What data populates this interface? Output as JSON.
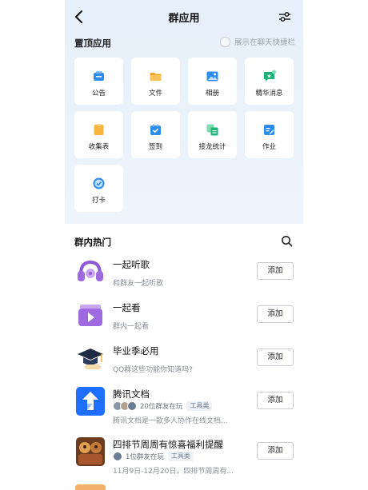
{
  "nav": {
    "title": "群应用"
  },
  "pinned": {
    "label": "置顶应用",
    "shortcut_text": "展示在聊天快捷栏",
    "apps": [
      {
        "label": "公告",
        "icon": "announcement-icon",
        "color": "#2d8cf0"
      },
      {
        "label": "文件",
        "icon": "folder-icon",
        "color": "#f5a623"
      },
      {
        "label": "相册",
        "icon": "album-icon",
        "color": "#2d8cf0"
      },
      {
        "label": "精华消息",
        "icon": "featured-message-icon",
        "color": "#1fb37a"
      },
      {
        "label": "收集表",
        "icon": "collection-form-icon",
        "color": "#f5b53d"
      },
      {
        "label": "签到",
        "icon": "check-in-icon",
        "color": "#2d8cf0"
      },
      {
        "label": "接龙统计",
        "icon": "relay-stats-icon",
        "color": "#1fb37a"
      },
      {
        "label": "作业",
        "icon": "homework-icon",
        "color": "#2d8cf0"
      },
      {
        "label": "打卡",
        "icon": "clock-in-icon",
        "color": "#2d8cf0"
      }
    ]
  },
  "hot": {
    "title": "群内热门",
    "items": [
      {
        "name": "一起听歌",
        "desc": "和群友一起听歌",
        "add": "添加",
        "icon": "listen-together-icon"
      },
      {
        "name": "一起看",
        "desc": "群内一起看",
        "add": "添加",
        "icon": "watch-together-icon"
      },
      {
        "name": "毕业季必用",
        "desc": "QQ群这些功能你知道吗?",
        "add": "添加",
        "icon": "graduation-cap-icon"
      },
      {
        "name": "腾讯文档",
        "meta": "20位群友在玩",
        "tag": "工具类",
        "desc": "腾讯文档是一款多人协作在线文档...",
        "add": "添加",
        "icon": "tencent-docs-icon"
      },
      {
        "name": "四排节周周有惊喜福利提醒",
        "meta": "1位群友在玩",
        "tag": "工具类",
        "desc": "11月9日-12月20日，四排节周周有...",
        "add": "添加",
        "icon": "game-avatar-icon"
      }
    ]
  }
}
